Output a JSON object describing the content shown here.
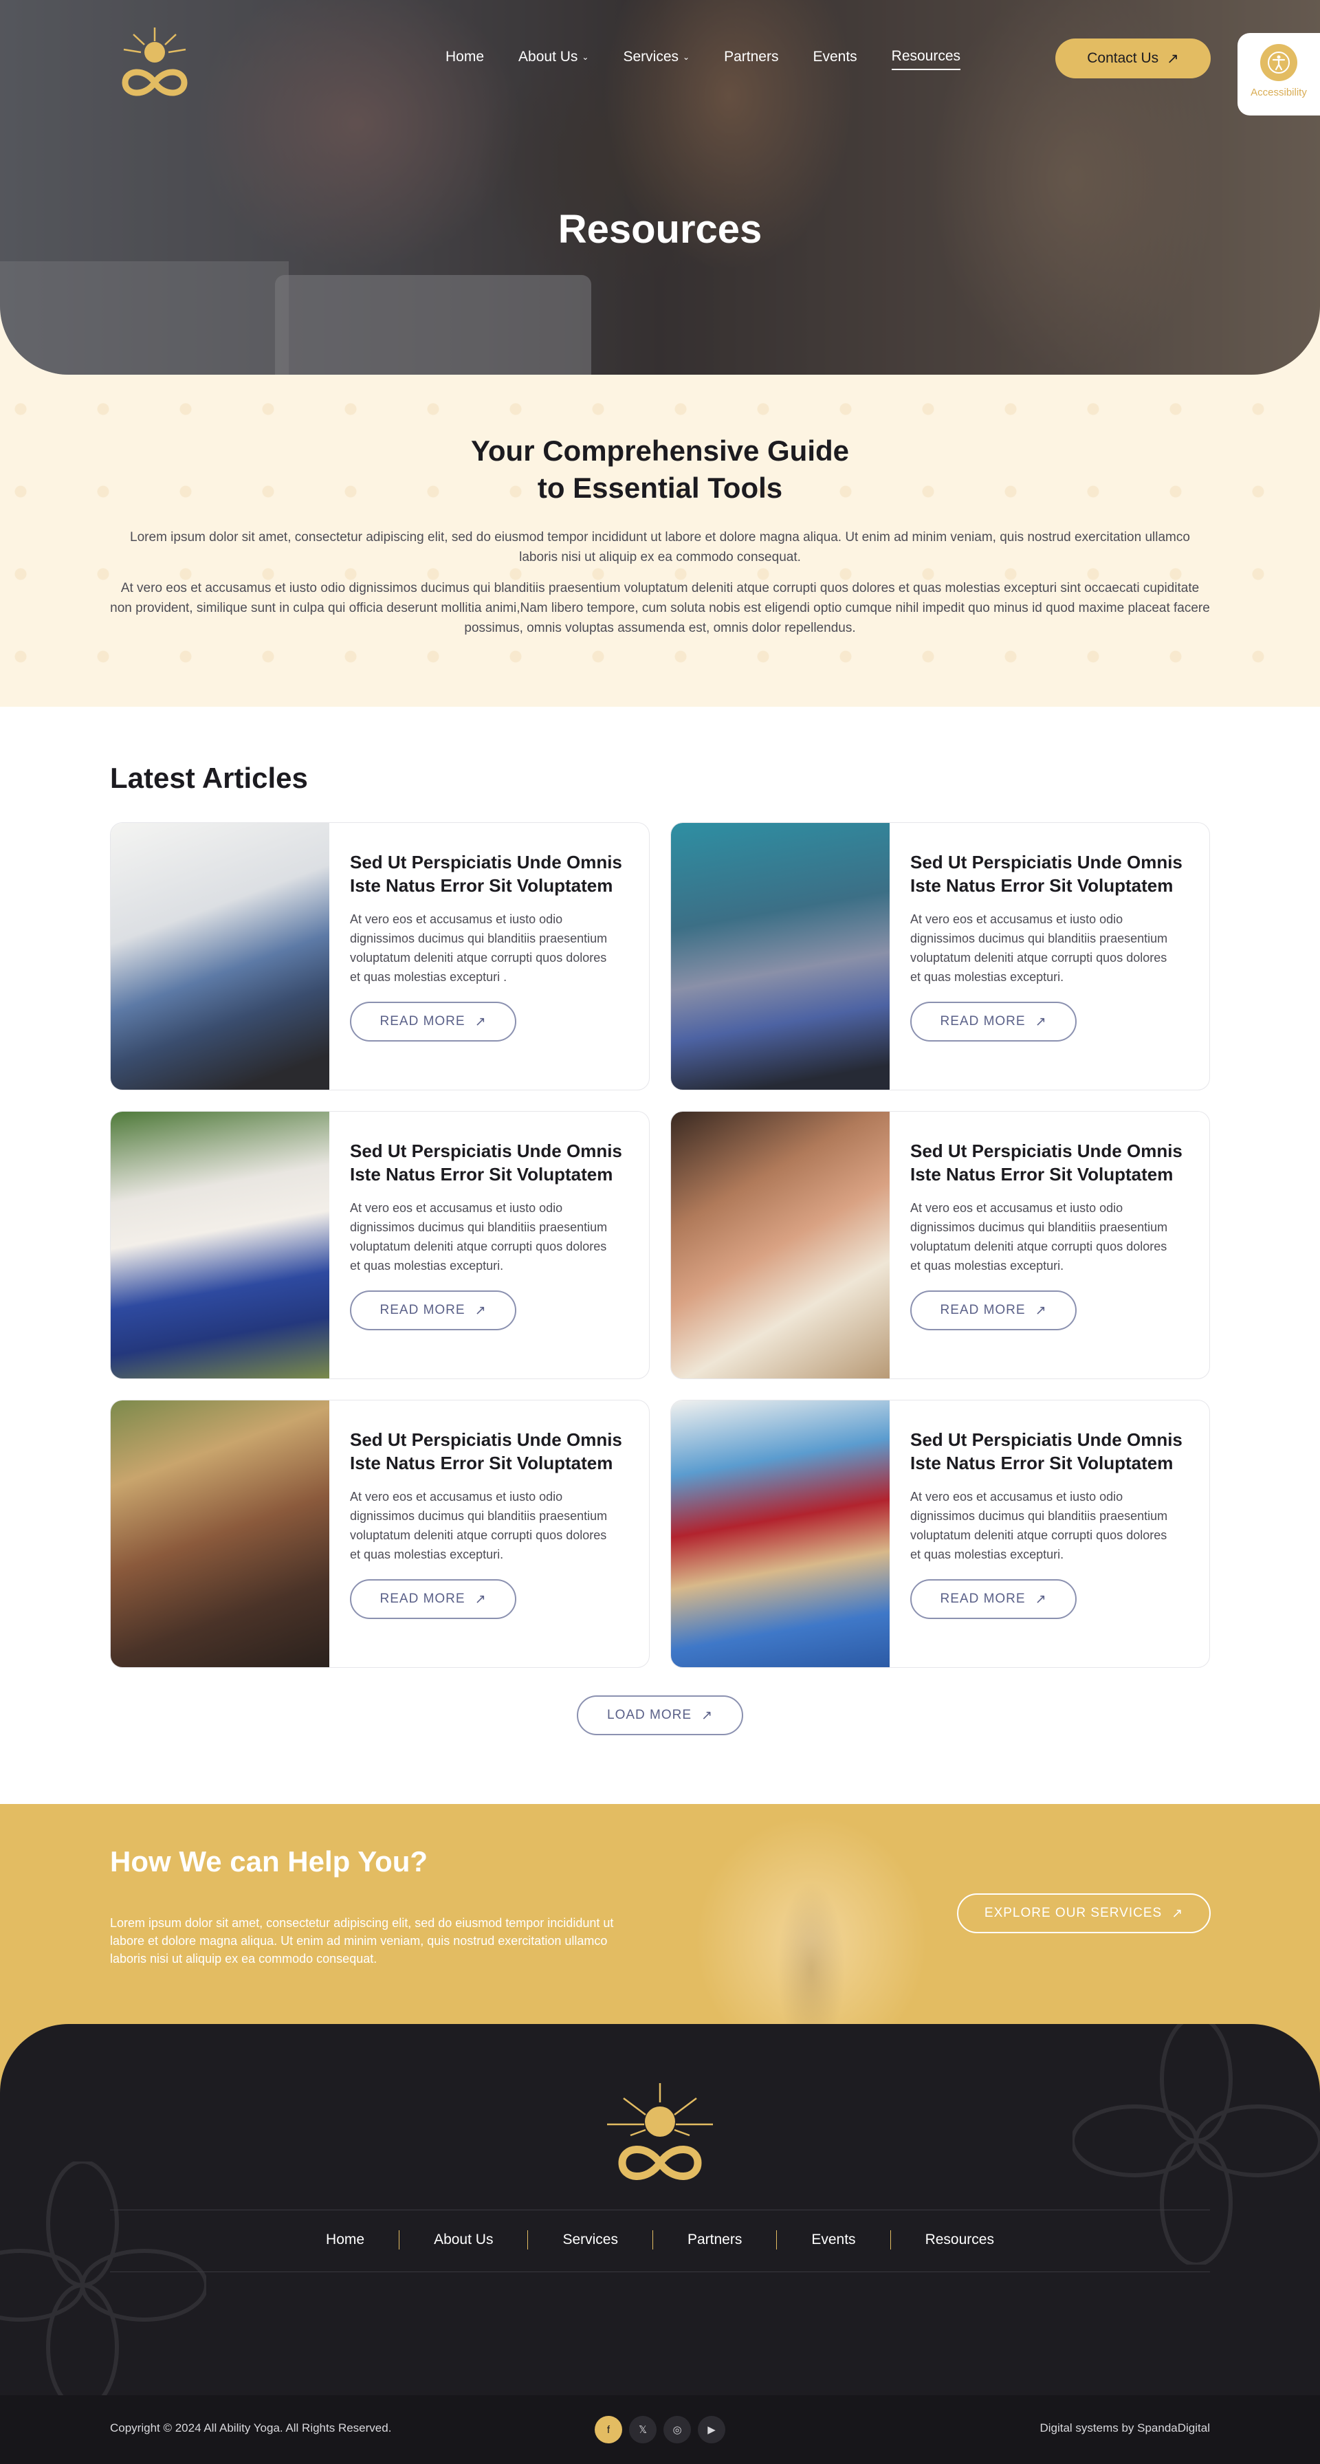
{
  "colors": {
    "accent": "#e3bc62",
    "dark": "#1d1c21",
    "cream": "#fdf4e2",
    "outline": "#8b91b0"
  },
  "nav": {
    "links": [
      {
        "label": "Home",
        "dropdown": false,
        "active": false
      },
      {
        "label": "About Us",
        "dropdown": true,
        "active": false
      },
      {
        "label": "Services",
        "dropdown": true,
        "active": false
      },
      {
        "label": "Partners",
        "dropdown": false,
        "active": false
      },
      {
        "label": "Events",
        "dropdown": false,
        "active": false
      },
      {
        "label": "Resources",
        "dropdown": false,
        "active": true
      }
    ],
    "contact_label": "Contact Us",
    "accessibility_label": "Accessibility"
  },
  "hero": {
    "title": "Resources"
  },
  "intro": {
    "heading": "Your Comprehensive Guide to Essential Tools",
    "para1": "Lorem ipsum dolor sit amet, consectetur adipiscing elit, sed do eiusmod tempor incididunt ut labore et dolore magna aliqua. Ut enim ad minim veniam, quis nostrud exercitation ullamco laboris nisi ut aliquip ex ea commodo consequat.",
    "para2": "At vero eos et accusamus et iusto odio dignissimos ducimus qui blanditiis praesentium voluptatum deleniti atque corrupti quos dolores et quas molestias excepturi sint occaecati cupiditate non provident, similique sunt in culpa qui officia deserunt mollitia animi,Nam libero tempore, cum soluta nobis est eligendi optio cumque nihil impedit quo minus id quod maxime placeat facere possimus, omnis voluptas assumenda est, omnis dolor repellendus."
  },
  "articles": {
    "heading": "Latest Articles",
    "read_more_label": "READ MORE",
    "load_more_label": "LOAD MORE",
    "items": [
      {
        "title": "Sed Ut Perspiciatis Unde Omnis Iste Natus Error Sit Voluptatem",
        "text": "At vero eos et accusamus et iusto odio dignissimos ducimus qui blanditiis praesentium voluptatum deleniti atque corrupti quos dolores et quas molestias excepturi .",
        "image": "stretching-therapy-photo"
      },
      {
        "title": "Sed Ut Perspiciatis Unde Omnis Iste Natus Error Sit Voluptatem",
        "text": "At vero eos et accusamus et iusto odio dignissimos ducimus qui blanditiis praesentium voluptatum deleniti atque corrupti quos dolores et quas molestias excepturi.",
        "image": "wheelchair-therapy-photo"
      },
      {
        "title": "Sed Ut Perspiciatis Unde Omnis Iste Natus Error Sit Voluptatem",
        "text": "At vero eos et accusamus et iusto odio dignissimos ducimus qui blanditiis praesentium voluptatum deleniti atque corrupti quos dolores et quas molestias excepturi.",
        "image": "seated-yoga-photo"
      },
      {
        "title": "Sed Ut Perspiciatis Unde Omnis Iste Natus Error Sit Voluptatem",
        "text": "At vero eos et accusamus et iusto odio dignissimos ducimus qui blanditiis praesentium voluptatum deleniti atque corrupti quos dolores et quas molestias excepturi.",
        "image": "foot-massage-photo"
      },
      {
        "title": "Sed Ut Perspiciatis Unde Omnis Iste Natus Error Sit Voluptatem",
        "text": "At vero eos et accusamus et iusto odio dignissimos ducimus qui blanditiis praesentium voluptatum deleniti atque corrupti quos dolores et quas molestias excepturi.",
        "image": "group-meditation-photo"
      },
      {
        "title": "Sed Ut Perspiciatis Unde Omnis Iste Natus Error Sit Voluptatem",
        "text": "At vero eos et accusamus et iusto odio dignissimos ducimus qui blanditiis praesentium voluptatum deleniti atque corrupti quos dolores et quas molestias excepturi.",
        "image": "band-exercise-photo"
      }
    ]
  },
  "help": {
    "heading": "How We can Help You?",
    "text": "Lorem ipsum dolor sit amet, consectetur adipiscing elit, sed do eiusmod tempor incididunt ut labore et dolore magna aliqua. Ut enim ad minim veniam, quis nostrud exercitation ullamco laboris nisi ut aliquip ex ea commodo consequat.",
    "button_label": "EXPLORE OUR SERVICES"
  },
  "footer": {
    "links": [
      "Home",
      "About Us",
      "Services",
      "Partners",
      "Events",
      "Resources"
    ],
    "copyright": "Copyright © 2024 All Ability Yoga. All Rights Reserved.",
    "credit": "Digital systems by SpandaDigital",
    "socials": [
      {
        "icon": "facebook-icon",
        "glyph": "f"
      },
      {
        "icon": "x-icon",
        "glyph": "𝕏"
      },
      {
        "icon": "instagram-icon",
        "glyph": "◎"
      },
      {
        "icon": "youtube-icon",
        "glyph": "▶"
      }
    ]
  }
}
